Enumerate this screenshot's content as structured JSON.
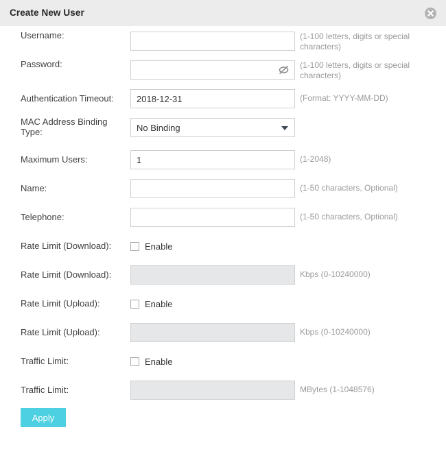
{
  "dialog": {
    "title": "Create New User",
    "close_icon": "close-circle-icon"
  },
  "form": {
    "rows": [
      {
        "label": "Username:",
        "type": "text",
        "value": "",
        "hint": "(1-100 letters, digits or special characters)",
        "name": "username",
        "two_line_label": false,
        "two_line_hint": true,
        "disabled": false
      },
      {
        "label": "Password:",
        "type": "password",
        "value": "",
        "hint": "(1-100 letters, digits or special characters)",
        "name": "password",
        "two_line_label": false,
        "two_line_hint": true,
        "disabled": false
      },
      {
        "label": "Authentication Timeout:",
        "type": "text",
        "value": "2018-12-31",
        "hint": "(Format: YYYY-MM-DD)",
        "name": "authentication-timeout",
        "two_line_label": false,
        "two_line_hint": false,
        "disabled": false
      },
      {
        "label": "MAC Address Binding Type:",
        "type": "select",
        "value": "No Binding",
        "hint": "",
        "name": "mac-address-binding-type",
        "two_line_label": true,
        "two_line_hint": false,
        "disabled": false
      },
      {
        "label": "Maximum Users:",
        "type": "text",
        "value": "1",
        "hint": "(1-2048)",
        "name": "maximum-users",
        "two_line_label": false,
        "two_line_hint": false,
        "disabled": false
      },
      {
        "label": "Name:",
        "type": "text",
        "value": "",
        "hint": "(1-50 characters, Optional)",
        "name": "name",
        "two_line_label": false,
        "two_line_hint": false,
        "disabled": false
      },
      {
        "label": "Telephone:",
        "type": "text",
        "value": "",
        "hint": "(1-50 characters, Optional)",
        "name": "telephone",
        "two_line_label": false,
        "two_line_hint": false,
        "disabled": false
      },
      {
        "label": "Rate Limit (Download):",
        "type": "checkbox",
        "value": "Enable",
        "checked": false,
        "hint": "",
        "name": "rate-limit-download-enable",
        "two_line_label": false,
        "two_line_hint": false,
        "disabled": false
      },
      {
        "label": "Rate Limit (Download):",
        "type": "text",
        "value": "",
        "hint": "Kbps (0-10240000)",
        "name": "rate-limit-download-value",
        "two_line_label": false,
        "two_line_hint": false,
        "disabled": true
      },
      {
        "label": "Rate Limit (Upload):",
        "type": "checkbox",
        "value": "Enable",
        "checked": false,
        "hint": "",
        "name": "rate-limit-upload-enable",
        "two_line_label": false,
        "two_line_hint": false,
        "disabled": false
      },
      {
        "label": "Rate Limit (Upload):",
        "type": "text",
        "value": "",
        "hint": "Kbps (0-10240000)",
        "name": "rate-limit-upload-value",
        "two_line_label": false,
        "two_line_hint": false,
        "disabled": true
      },
      {
        "label": "Traffic Limit:",
        "type": "checkbox",
        "value": "Enable",
        "checked": false,
        "hint": "",
        "name": "traffic-limit-enable",
        "two_line_label": false,
        "two_line_hint": false,
        "disabled": false
      },
      {
        "label": "Traffic Limit:",
        "type": "text",
        "value": "",
        "hint": "MBytes (1-1048576)",
        "name": "traffic-limit-value",
        "two_line_label": false,
        "two_line_hint": false,
        "disabled": true
      }
    ],
    "apply_label": "Apply"
  },
  "icons": {
    "password_toggle": "eye-slash-icon",
    "dropdown": "chevron-down-icon"
  },
  "colors": {
    "header_bg": "#ececec",
    "apply_button": "#4dd0e1",
    "hint_text": "#9a9a9a",
    "disabled_input": "#e6e7e8",
    "input_border": "#cfcfcf",
    "close_button": "#b3b3b3"
  }
}
